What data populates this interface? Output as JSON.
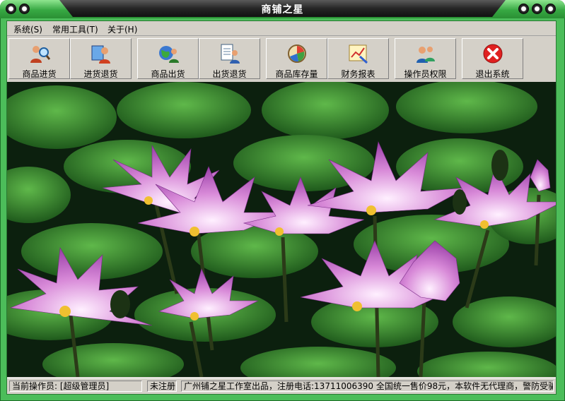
{
  "window": {
    "title": "商铺之星"
  },
  "menu": [
    {
      "label": "系统(S)"
    },
    {
      "label": "常用工具(T)"
    },
    {
      "label": "关于(H)"
    }
  ],
  "toolbar": [
    {
      "label": "商品进货",
      "icon": "users-search-icon"
    },
    {
      "label": "进货退货",
      "icon": "return-goods-icon"
    },
    {
      "label": "商品出货",
      "icon": "globe-user-icon"
    },
    {
      "label": "出货退货",
      "icon": "document-user-icon"
    },
    {
      "label": "商品库存量",
      "icon": "compass-chart-icon"
    },
    {
      "label": "财务报表",
      "icon": "report-chart-icon"
    },
    {
      "label": "操作员权限",
      "icon": "operators-icon"
    },
    {
      "label": "退出系统",
      "icon": "exit-icon"
    }
  ],
  "status": {
    "operator": "当前操作员:  [超级管理员]",
    "registration": "未注册",
    "notice": "广州铺之星工作室出品，注册电话:13711006390 全国统一售价98元，本软件无代理商，警防受骗!"
  },
  "colors": {
    "frame": "#4cbd5a",
    "title_dark": "#1a1a1a",
    "face": "#d4d0c8",
    "exit": "#e02020"
  }
}
